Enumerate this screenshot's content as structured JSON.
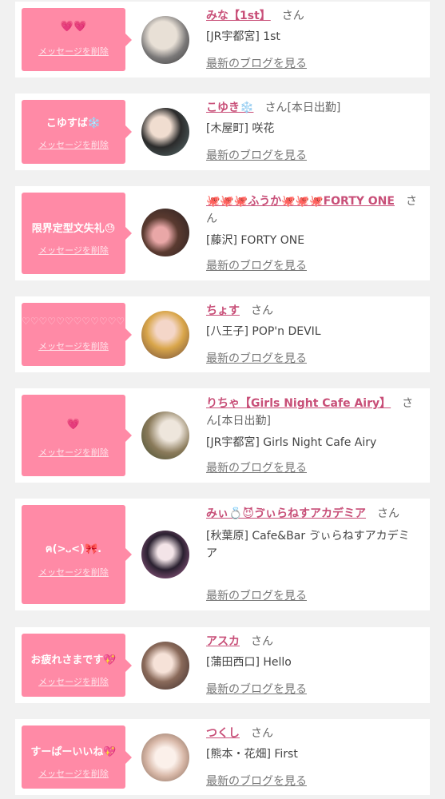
{
  "delete_label": "メッセージを削除",
  "san_label": "さん",
  "blog_label": "最新のブログを見る",
  "accent_color": "#ff8aa6",
  "name_color": "#c84f78",
  "items": [
    {
      "message": "💗💗",
      "name": "みな【1st】",
      "status": "",
      "shop": "[JR宇都宮] 1st"
    },
    {
      "message": "こゆすば❄️",
      "name": "こゆき❄️",
      "status": "[本日出勤]",
      "shop": "[木屋町] 咲花"
    },
    {
      "message": "限界定型文失礼😓",
      "name": "🐙🐙🐙ふうか🐙🐙🐙FORTY ONE",
      "status": "",
      "shop": "[藤沢] FORTY ONE"
    },
    {
      "message": "♡♡♡♡♡♡♡♡♡♡♡♡♡",
      "name": "ちょす",
      "status": "",
      "shop": "[八王子] POP'n DEVIL"
    },
    {
      "message": "💗",
      "name": "りちゃ【Girls Night Cafe Airy】",
      "status": "[本日出勤]",
      "shop": "[JR宇都宮] Girls Night Cafe Airy"
    },
    {
      "message": "ฅ(>᎑<)🎀.",
      "name": "みぃ💍😈ゔぃらねすアカデミア",
      "status": "",
      "shop": "[秋葉原] Cafe&Bar ゔぃらねすアカデミア"
    },
    {
      "message": "お疲れさまです💖",
      "name": "アスカ",
      "status": "",
      "shop": "[蒲田西口] Hello"
    },
    {
      "message": "すーぱーいいね💖",
      "name": "つくし",
      "status": "",
      "shop": "[熊本・花畑] First"
    }
  ]
}
